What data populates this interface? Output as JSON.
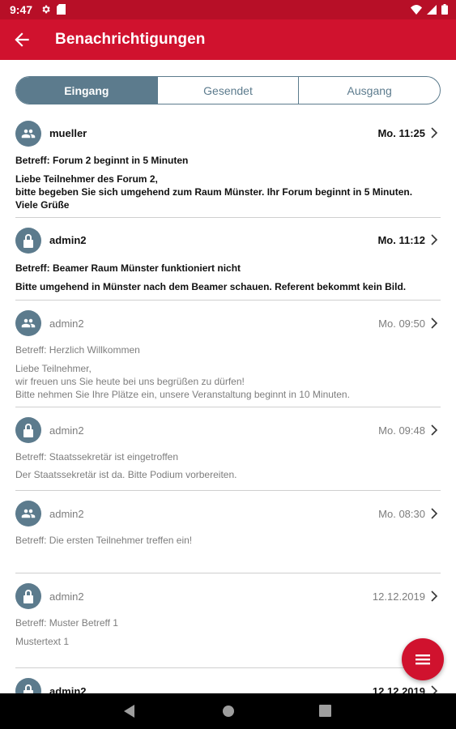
{
  "status_bar": {
    "time": "9:47"
  },
  "app_bar": {
    "title": "Benachrichtigungen"
  },
  "tabs": [
    {
      "label": "Eingang",
      "active": true
    },
    {
      "label": "Gesendet",
      "active": false
    },
    {
      "label": "Ausgang",
      "active": false
    }
  ],
  "messages": [
    {
      "icon": "group-icon",
      "sender": "mueller",
      "date": "Mo. 11:25",
      "unread": true,
      "subject": "Betreff: Forum 2 beginnt in 5 Minuten",
      "body": "Liebe Teilnehmer des Forum 2,\nbitte begeben Sie sich umgehend zum Raum Münster. Ihr Forum beginnt in 5 Minuten.\nViele Grüße"
    },
    {
      "icon": "lock-icon",
      "sender": "admin2",
      "date": "Mo. 11:12",
      "unread": true,
      "subject": "Betreff: Beamer Raum Münster funktioniert nicht",
      "body": "Bitte umgehend in Münster nach dem Beamer schauen. Referent bekommt kein Bild."
    },
    {
      "icon": "group-icon",
      "sender": "admin2",
      "date": "Mo. 09:50",
      "unread": false,
      "subject": "Betreff: Herzlich Willkommen",
      "body": "Liebe Teilnehmer,\nwir freuen uns Sie heute bei uns begrüßen zu dürfen!\nBitte nehmen Sie Ihre Plätze ein, unsere Veranstaltung beginnt in 10 Minuten."
    },
    {
      "icon": "lock-icon",
      "sender": "admin2",
      "date": "Mo. 09:48",
      "unread": false,
      "subject": "Betreff: Staatssekretär ist eingetroffen",
      "body": "Der Staatssekretär ist da. Bitte Podium vorbereiten."
    },
    {
      "icon": "group-icon",
      "sender": "admin2",
      "date": "Mo. 08:30",
      "unread": false,
      "subject": "Betreff: Die ersten Teilnehmer treffen ein!",
      "body": ""
    },
    {
      "icon": "lock-icon",
      "sender": "admin2",
      "date": "12.12.2019",
      "unread": false,
      "subject": "Betreff: Muster Betreff 1",
      "body": "Mustertext 1"
    },
    {
      "icon": "lock-icon",
      "sender": "admin2",
      "date": "12.12.2019",
      "unread": true,
      "subject": "",
      "body": ""
    }
  ],
  "colors": {
    "primary": "#d0122e",
    "status_bar": "#b70f27",
    "accent": "#5c7b8d"
  }
}
